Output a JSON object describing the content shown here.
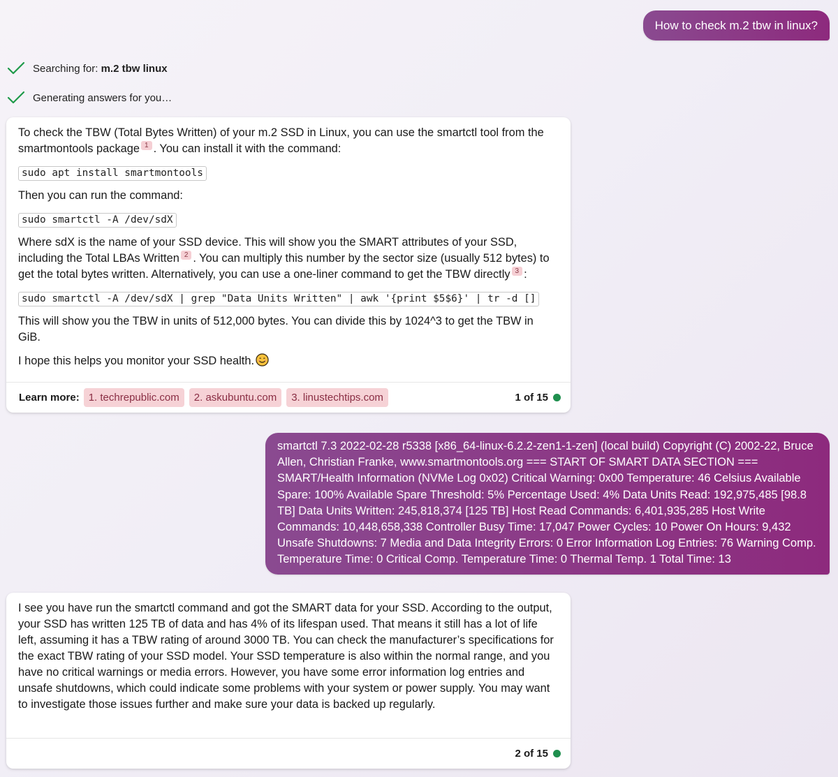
{
  "conversation": {
    "user_messages": [
      "How to check m.2 tbw in linux?",
      "smartctl 7.3 2022-02-28 r5338 [x86_64-linux-6.2.2-zen1-1-zen] (local build) Copyright (C) 2002-22, Bruce Allen, Christian Franke, www.smartmontools.org === START OF SMART DATA SECTION === SMART/Health Information (NVMe Log 0x02) Critical Warning: 0x00 Temperature: 46 Celsius Available Spare: 100% Available Spare Threshold: 5% Percentage Used: 4% Data Units Read: 192,975,485 [98.8 TB] Data Units Written: 245,818,374 [125 TB] Host Read Commands: 6,401,935,285 Host Write Commands: 10,448,658,338 Controller Busy Time: 17,047 Power Cycles: 10 Power On Hours: 9,432 Unsafe Shutdowns: 7 Media and Data Integrity Errors: 0 Error Information Log Entries: 76 Warning Comp. Temperature Time: 0 Critical Comp. Temperature Time: 0 Thermal Temp. 1 Total Time: 13"
    ],
    "status": {
      "searching_prefix": "Searching for: ",
      "searching_query": "m.2 tbw linux",
      "generating": "Generating answers for you…"
    },
    "answer1": {
      "p1_a": "To check the TBW (Total Bytes Written) of your m.2 SSD in Linux, you can use the smartctl tool from the smartmontools package",
      "cite1": "1",
      "p1_b": ". You can install it with the command:",
      "code1": "sudo apt install smartmontools",
      "p2": "Then you can run the command:",
      "code2": "sudo smartctl -A /dev/sdX",
      "p3_a": "Where sdX is the name of your SSD device. This will show you the SMART attributes of your SSD, including the Total LBAs Written",
      "cite2": "2",
      "p3_b": ". You can multiply this number by the sector size (usually 512 bytes) to get the total bytes written. Alternatively, you can use a one-liner command to get the TBW directly",
      "cite3": "3",
      "p3_c": ":",
      "code3": "sudo smartctl -A /dev/sdX | grep \"Data Units Written\" | awk '{print $5$6}' | tr -d []",
      "p4": "This will show you the TBW in units of 512,000 bytes. You can divide this by 1024^3 to get the TBW in GiB.",
      "p5": "I hope this helps you monitor your SSD health.",
      "learn_more_label": "Learn more:",
      "sources": [
        "1. techrepublic.com",
        "2. askubuntu.com",
        "3. linustechtips.com"
      ],
      "page_indicator": "1 of 15"
    },
    "answer2": {
      "text": "I see you have run the smartctl command and got the SMART data for your SSD. According to the output, your SSD has written 125 TB of data and has 4% of its lifespan used. That means it still has a lot of life left, assuming it has a TBW rating of around 3000 TB. You can check the manufacturer’s specifications for the exact TBW rating of your SSD model. Your SSD temperature is also within the normal range, and you have no critical warnings or media errors. However, you have some error information log entries and unsafe shutdowns, which could indicate some problems with your system or power supply. You may want to investigate those issues further and make sure your data is backed up regularly.",
      "page_indicator": "2 of 15"
    }
  },
  "colors": {
    "user_bubble_start": "#8a4a90",
    "user_bubble_end": "#8d2a7d",
    "check_green": "#1f9a4a",
    "status_dot": "#1f8f4e",
    "source_chip_bg": "#f6d2d6"
  },
  "icons": [
    "check-icon",
    "smile-emoji-icon",
    "status-dot-icon"
  ]
}
